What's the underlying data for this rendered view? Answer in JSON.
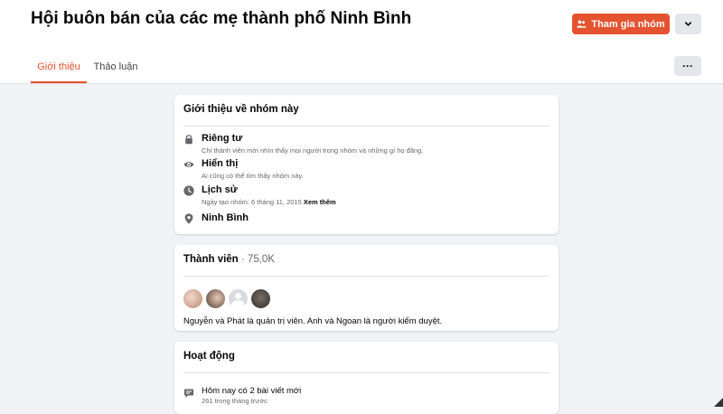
{
  "header": {
    "group_name": "Hội buôn bán của các mẹ thành phố Ninh Bình",
    "join_button": "Tham gia nhóm",
    "more_button": "···"
  },
  "tabs": [
    {
      "label": "Giới thiệu",
      "active": true
    },
    {
      "label": "Thảo luận",
      "active": false
    }
  ],
  "about": {
    "heading": "Giới thiệu về nhóm này",
    "items": [
      {
        "icon": "lock-icon",
        "title": "Riêng tư",
        "desc": "Chỉ thành viên mới nhìn thấy mọi người trong nhóm và những gì họ đăng."
      },
      {
        "icon": "eye-icon",
        "title": "Hiển thị",
        "desc": "Ai cũng có thể tìm thấy nhóm này."
      },
      {
        "icon": "clock-icon",
        "title": "Lịch sử",
        "desc": "Ngày tạo nhóm: 6 tháng 11, 2015",
        "link": "Xem thêm"
      },
      {
        "icon": "location-icon",
        "title": "Ninh Bình"
      }
    ]
  },
  "members": {
    "heading": "Thành viên",
    "count": " · 75,0K",
    "admins_text": "Nguyễn và Phát là quản trị viên. Anh và Ngoan là người kiểm duyệt."
  },
  "activity": {
    "heading": "Hoạt động",
    "posts_today": "Hôm nay có 2 bài viết mới",
    "posts_last_month": "261 trong tháng trước"
  },
  "colors": {
    "accent": "#e4532f",
    "background": "#f0f2f5",
    "secondary_text": "#65676b"
  }
}
